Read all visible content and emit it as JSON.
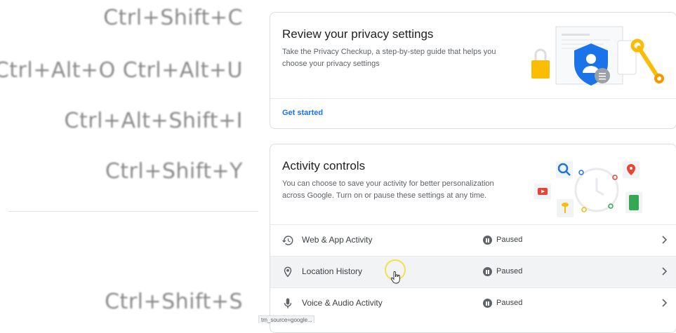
{
  "shortcuts": {
    "items": [
      "Ctrl+Shift+C",
      "Ctrl+Alt+O Ctrl+Alt+U",
      "Ctrl+Alt+Shift+I",
      "Ctrl+Shift+Y",
      "Ctrl+Shift+S"
    ]
  },
  "privacy_card": {
    "title": "Review your privacy settings",
    "description": "Take the Privacy Checkup, a step-by-step guide that helps you choose your privacy settings",
    "link": "Get started"
  },
  "activity_card": {
    "title": "Activity controls",
    "description": "You can choose to save your activity for better personalization across Google. Turn on or pause these settings at any time.",
    "rows": [
      {
        "label": "Web & App Activity",
        "status": "Paused",
        "icon": "history-icon"
      },
      {
        "label": "Location History",
        "status": "Paused",
        "icon": "location-pin-icon"
      },
      {
        "label": "Voice & Audio Activity",
        "status": "Paused",
        "icon": "microphone-icon"
      }
    ]
  },
  "status_bar": {
    "url": "tm_source=google..."
  },
  "colors": {
    "link": "#1a73e8",
    "title": "#202124",
    "body": "#5f6368",
    "cursor_ring": "#f0e34a"
  }
}
